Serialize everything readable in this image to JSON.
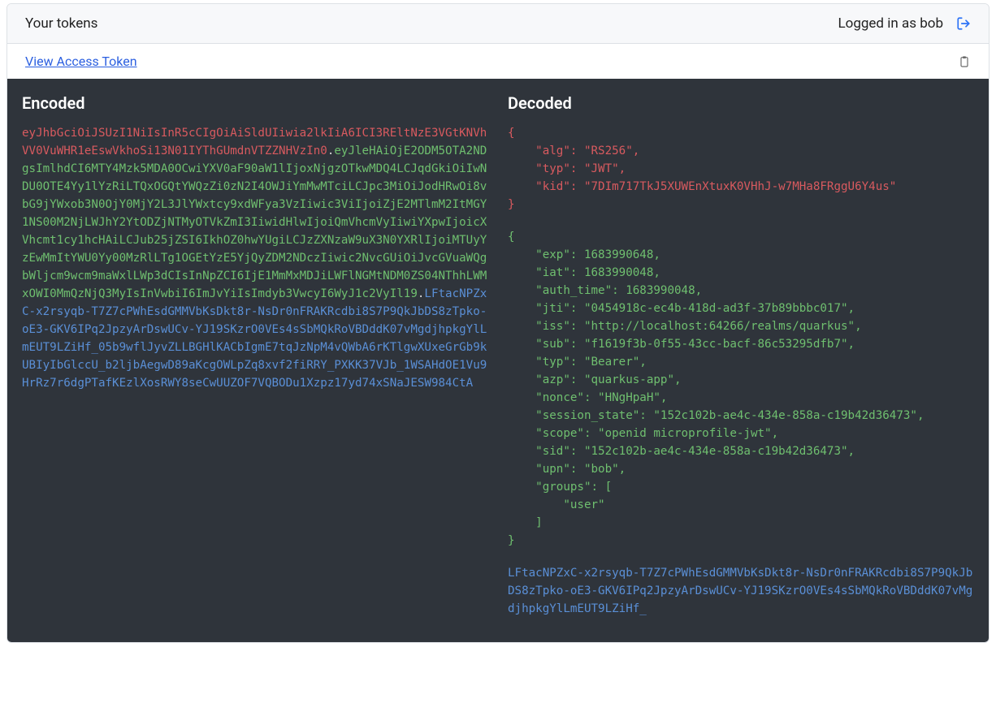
{
  "header": {
    "title": "Your tokens",
    "login_text": "Logged in as bob"
  },
  "toolbar": {
    "view_link": "View Access Token"
  },
  "encoded": {
    "heading": "Encoded",
    "header_part": "eyJhbGciOiJSUzI1NiIsInR5cCIgOiAiSldUIiwia2lkIiA6ICI3REltNzE3VGtKNVhVV0VuWHR1eEswVkhoSi13N01IYThGUmdnVTZZNHVzIn0",
    "payload_part": "eyJleHAiOjE2ODM5OTA2NDgsImlhdCI6MTY4Mzk5MDA0OCwiYXV0aF90aW1lIjoxNjgzOTkwMDQ4LCJqdGkiOiIwNDU0OTE4Yy1lYzRiLTQxOGQtYWQzZi0zN2I4OWJiYmMwMTciLCJpc3MiOiJodHRwOi8vbG9jYWxob3N0OjY0MjY2L3JlYWxtcy9xdWFya3VzIiwic3ViIjoiZjE2MTlmM2ItMGY1NS00M2NjLWJhY2YtODZjNTMyOTVkZmI3IiwidHlwIjoiQmVhcmVyIiwiYXpwIjoicXVhcmt1cy1hcHAiLCJub25jZSI6IkhOZ0hwYUgiLCJzZXNzaW9uX3N0YXRlIjoiMTUyYzEwMmItYWU0Yy00MzRlLTg1OGEtYzE5YjQyZDM2NDczIiwic2NvcGUiOiJvcGVuaWQgbWljcm9wcm9maWxlLWp3dCIsInNpZCI6IjE1MmMxMDJiLWFlNGMtNDM0ZS04NThhLWMxOWI0MmQzNjQ3MyIsInVwbiI6ImJvYiIsImdyb3VwcyI6WyJ1c2VyIl19",
    "signature_part": "LFtacNPZxC-x2rsyqb-T7Z7cPWhEsdGMMVbKsDkt8r-NsDr0nFRAKRcdbi8S7P9QkJbDS8zTpko-oE3-GKV6IPq2JpzyArDswUCv-YJ19SKzrO0VEs4sSbMQkRoVBDddK07vMgdjhpkgYlLmEUT9LZiHf_05b9wflJyvZLLBGHlKACbIgmE7tqJzNpM4vQWbA6rKTlgwXUxeGrGb9kUBIyIbGlccU_b2ljbAegwD89aKcgOWLpZq8xvf2fiRRY_PXKK37VJb_1WSAHdOE1Vu9HrRz7r6dgPTafKEzlXosRWY8seCwUUZOF7VQBODu1Xzpz17yd74xSNaJESW984CtA"
  },
  "decoded": {
    "heading": "Decoded",
    "header_json": {
      "alg": "RS256",
      "typ": "JWT",
      "kid": "7DIm717TkJ5XUWEnXtuxK0VHhJ-w7MHa8FRggU6Y4us"
    },
    "payload_json": {
      "exp": 1683990648,
      "iat": 1683990048,
      "auth_time": 1683990048,
      "jti": "0454918c-ec4b-418d-ad3f-37b89bbbc017",
      "iss": "http://localhost:64266/realms/quarkus",
      "sub": "f1619f3b-0f55-43cc-bacf-86c53295dfb7",
      "typ": "Bearer",
      "azp": "quarkus-app",
      "nonce": "HNgHpaH",
      "session_state": "152c102b-ae4c-434e-858a-c19b42d36473",
      "scope": "openid microprofile-jwt",
      "sid": "152c102b-ae4c-434e-858a-c19b42d36473",
      "upn": "bob",
      "groups": [
        "user"
      ]
    },
    "signature_text": "LFtacNPZxC-x2rsyqb-T7Z7cPWhEsdGMMVbKsDkt8r-NsDr0nFRAKRcdbi8S7P9QkJbDS8zTpko-oE3-GKV6IPq2JpzyArDswUCv-YJ19SKzrO0VEs4sSbMQkRoVBDddK07vMgdjhpkgYlLmEUT9LZiHf_"
  }
}
